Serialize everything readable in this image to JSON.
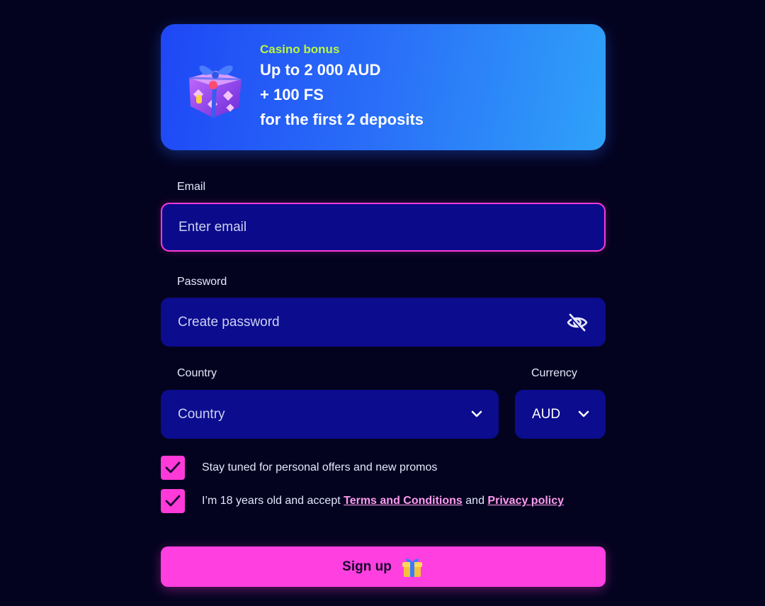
{
  "banner": {
    "tag": "Casino bonus",
    "lines": [
      "Up to 2 000 AUD",
      "+ 100 FS",
      "for the first 2 deposits"
    ],
    "icon": "gift-box-icon"
  },
  "email": {
    "label": "Email",
    "placeholder": "Enter email",
    "value": ""
  },
  "password": {
    "label": "Password",
    "placeholder": "Create password",
    "value": "",
    "toggle_icon": "eye-slash-icon"
  },
  "country": {
    "label": "Country",
    "selected": "Country",
    "icon": "chevron-down-icon"
  },
  "currency": {
    "label": "Currency",
    "selected": "AUD",
    "icon": "chevron-down-icon"
  },
  "consents": {
    "promos": {
      "checked": true,
      "text": "Stay tuned for personal offers and new promos"
    },
    "terms": {
      "checked": true,
      "prefix": "I’m 18 years old and accept ",
      "terms_link": "Terms and Conditions",
      "joiner": " and ",
      "privacy_link": "Privacy policy"
    }
  },
  "signup": {
    "label": "Sign up",
    "icon": "gift-icon"
  },
  "colors": {
    "background": "#04031f",
    "field": "#0b0c8e",
    "accent": "#ff3fe0",
    "bonus_tag": "#b9f542",
    "banner_start": "#1e47f5",
    "banner_end": "#2fa2f9"
  }
}
